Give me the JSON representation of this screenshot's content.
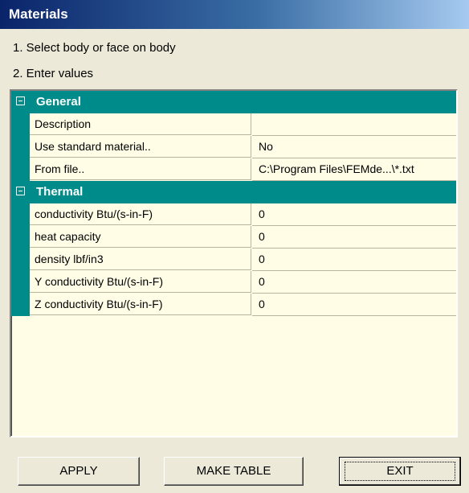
{
  "window": {
    "title": "Materials"
  },
  "instructions": [
    "1. Select body or face on body",
    "2. Enter values"
  ],
  "grid": {
    "categories": [
      {
        "label": "General",
        "expanded": true,
        "rows": [
          {
            "name": "Description",
            "value": ""
          },
          {
            "name": "Use standard material..",
            "value": "No"
          },
          {
            "name": "From file..",
            "value": "C:\\Program Files\\FEMde...\\*.txt"
          }
        ]
      },
      {
        "label": "Thermal",
        "expanded": true,
        "rows": [
          {
            "name": "conductivity Btu/(s-in-F)",
            "value": "0"
          },
          {
            "name": "heat capacity",
            "value": "0"
          },
          {
            "name": "density lbf/in3",
            "value": "0"
          },
          {
            "name": "Y conductivity Btu/(s-in-F)",
            "value": "0"
          },
          {
            "name": "Z conductivity Btu/(s-in-F)",
            "value": "0"
          }
        ]
      }
    ]
  },
  "buttons": {
    "apply": "APPLY",
    "make_table": "MAKE TABLE",
    "exit": "EXIT"
  },
  "colors": {
    "category_bg": "#008b8b",
    "grid_bg": "#fffde6",
    "window_bg": "#ece9d8",
    "title_gradient_start": "#0a246a"
  },
  "icons": {
    "collapse": "minus-box-icon"
  }
}
